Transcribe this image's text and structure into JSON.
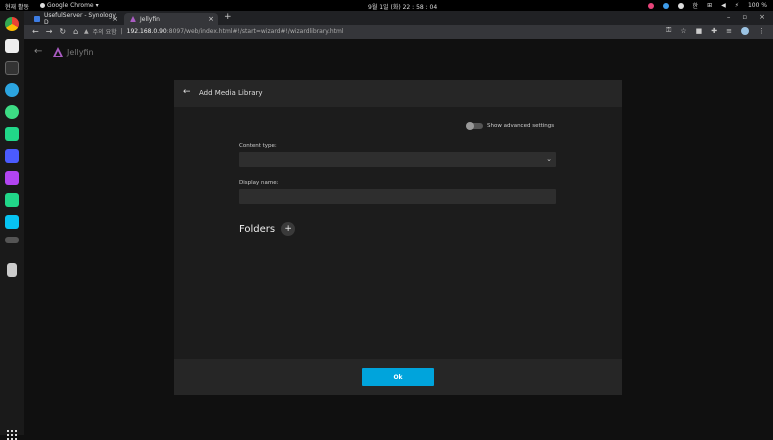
{
  "system": {
    "activities_label": "현재 활동",
    "app_name": "Google Chrome",
    "clock": "9월 1일 (화) 22 : 58 : 04",
    "input_method": "한",
    "battery": "100 %"
  },
  "browser": {
    "tabs": [
      {
        "label": "UsefulServer - Synology D",
        "close": "×",
        "favicon_color": "#3d7de4"
      },
      {
        "label": "Jellyfin",
        "close": "×",
        "favicon_color": "#aa5cc3"
      }
    ],
    "new_tab": "+",
    "window_controls": [
      "–",
      "▫",
      "×"
    ],
    "security_label": "주의 요함",
    "url_host": "192.168.0.90",
    "url_rest": ":8097/web/index.html#!/start=wizard#!/wizardlibrary.html"
  },
  "app": {
    "back_arrow": "←",
    "logo_text": "Jellyfin"
  },
  "dialog": {
    "back_arrow": "←",
    "title": "Add Media Library",
    "advanced_label": "Show advanced settings",
    "content_type_label": "Content type:",
    "content_type_value": "",
    "display_name_label": "Display name:",
    "display_name_value": "",
    "folders_title": "Folders",
    "add_folder": "+",
    "ok_label": "Ok"
  },
  "colors": {
    "accent": "#00a4dc",
    "background": "#101010",
    "dialog": "#1c1c1c"
  }
}
